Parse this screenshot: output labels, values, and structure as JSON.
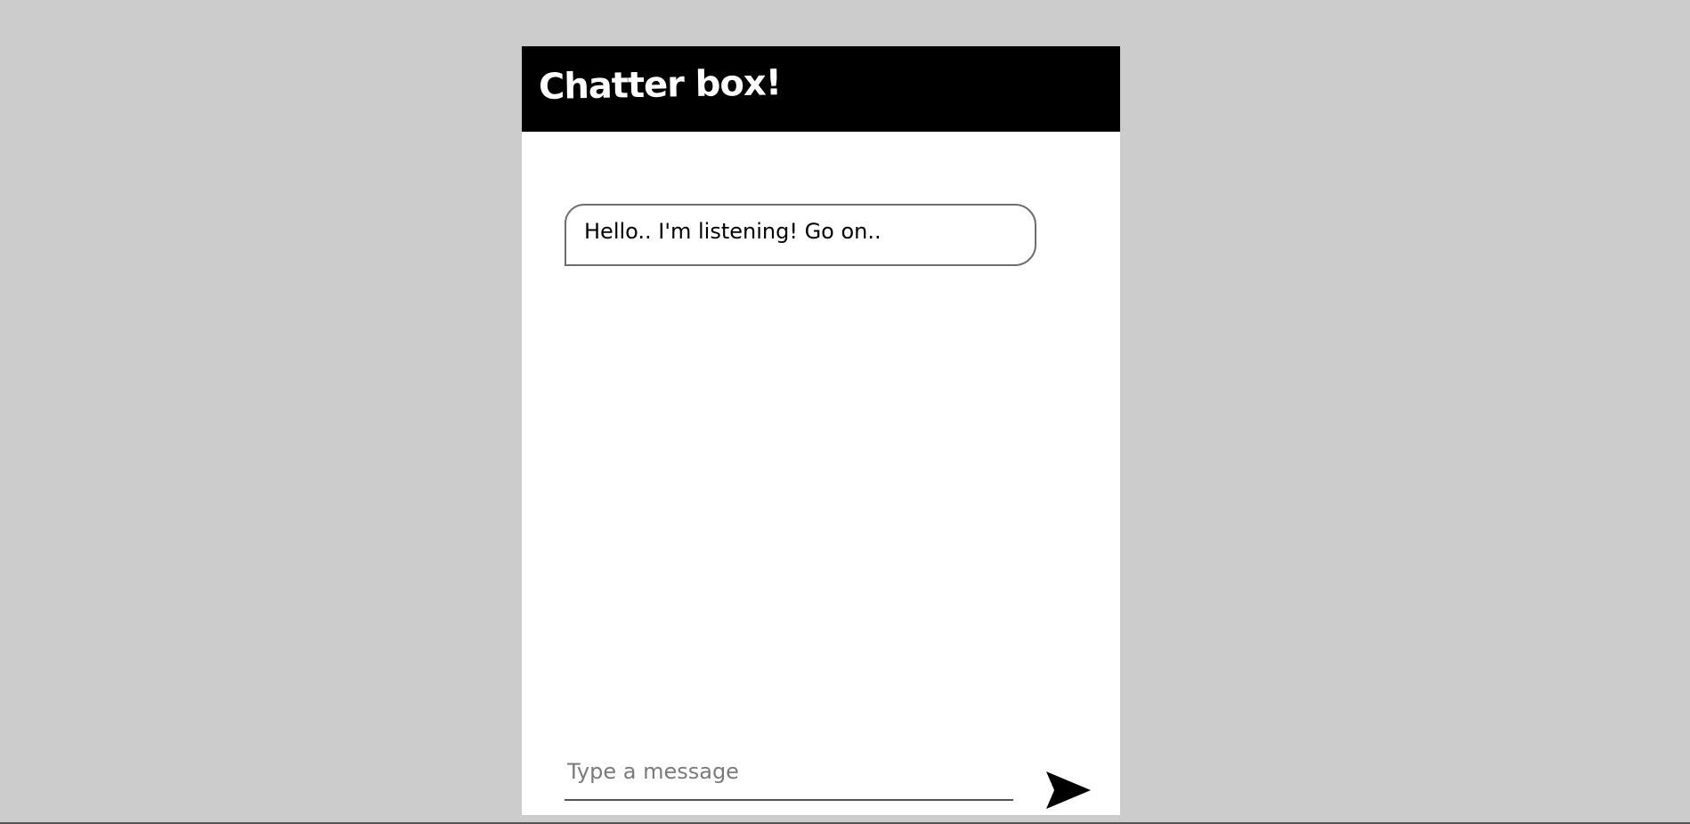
{
  "header": {
    "title": "Chatter box!"
  },
  "messages": [
    {
      "text": "Hello.. I'm listening! Go on.."
    }
  ],
  "composer": {
    "placeholder": "Type a message",
    "value": "",
    "send_icon": "send-icon"
  },
  "colors": {
    "page_background": "#cccccc",
    "header_background": "#000000",
    "header_text": "#ffffff",
    "panel_background": "#ffffff",
    "bubble_border": "#6e6e6e",
    "placeholder": "#7a7a7a"
  }
}
